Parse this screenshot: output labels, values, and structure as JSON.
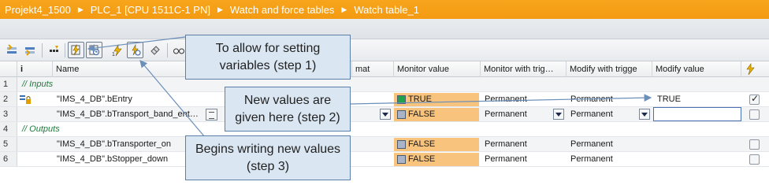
{
  "breadcrumb": {
    "items": [
      "Projekt4_1500",
      "PLC_1 [CPU 1511C-1 PN]",
      "Watch and force tables",
      "Watch table_1"
    ],
    "separator": "▶"
  },
  "toolbar": {
    "buttons": [
      {
        "name": "insert-row-icon"
      },
      {
        "name": "add-row-icon"
      },
      {
        "name": "show-all-modify-icon"
      },
      {
        "name": "modify-now-icon"
      },
      {
        "name": "modify-trigger-icon"
      },
      {
        "name": "force-icon"
      },
      {
        "name": "modify-with-trigger-icon"
      },
      {
        "name": "copy-icon"
      },
      {
        "name": "glasses-icon"
      },
      {
        "name": "monitor-all-icon"
      }
    ]
  },
  "table": {
    "headers": {
      "info": "i",
      "name": "Name",
      "format": "mat",
      "monitor_value": "Monitor value",
      "monitor_trigger": "Monitor with trig…",
      "modify_trigger": "Modify  with trigge",
      "modify_value": "Modify value"
    },
    "rows": [
      {
        "num": "1",
        "group": "// Inputs"
      },
      {
        "num": "2",
        "name": "\"IMS_4_DB\".bEntry",
        "monitor": "TRUE",
        "monitor_state": "green",
        "monitor_trigger": "Permanent",
        "modify_trigger": "Permanent",
        "modify_value": "TRUE",
        "checked": true
      },
      {
        "num": "3",
        "name": "\"IMS_4_DB\".bTransport_band_ent…",
        "monitor": "FALSE",
        "monitor_state": "grey",
        "monitor_trigger": "Permanent",
        "modify_trigger": "Permanent",
        "modify_value": "",
        "checked": false
      },
      {
        "num": "4",
        "group": "// Outputs"
      },
      {
        "num": "5",
        "name": "\"IMS_4_DB\".bTransporter_on",
        "monitor": "FALSE",
        "monitor_state": "grey",
        "monitor_trigger": "Permanent",
        "modify_trigger": "Permanent",
        "modify_value": "",
        "checked": false
      },
      {
        "num": "6",
        "name": "\"IMS_4_DB\".bStopper_down",
        "monitor": "FALSE",
        "monitor_state": "grey",
        "monitor_trigger": "Permanent",
        "modify_trigger": "Permanent",
        "modify_value": "",
        "checked": false
      }
    ]
  },
  "callouts": {
    "step1": "To allow for setting variables (step 1)",
    "step2": "New values are given here (step 2)",
    "step3": "Begins writing new values (step 3)"
  },
  "colors": {
    "breadcrumb_bg": "#f39a12",
    "monitor_bg": "#f7c37d",
    "monitor_true": "#1fa24a",
    "callout_bg": "#dae6f1",
    "callout_border": "#5b7fa8",
    "arrow": "#6b8fb8"
  }
}
